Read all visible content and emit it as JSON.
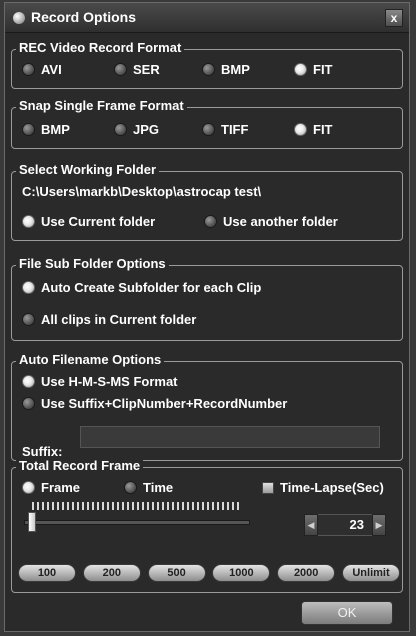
{
  "window": {
    "title": "Record Options",
    "close_label": "x"
  },
  "rec_video_format": {
    "legend": "REC Video Record Format",
    "options": [
      {
        "label": "AVI",
        "selected": false
      },
      {
        "label": "SER",
        "selected": false
      },
      {
        "label": "BMP",
        "selected": false
      },
      {
        "label": "FIT",
        "selected": true
      }
    ]
  },
  "snap_format": {
    "legend": "Snap Single Frame Format",
    "options": [
      {
        "label": "BMP",
        "selected": false
      },
      {
        "label": "JPG",
        "selected": false
      },
      {
        "label": "TIFF",
        "selected": false
      },
      {
        "label": "FIT",
        "selected": true
      }
    ]
  },
  "working_folder": {
    "legend": "Select Working Folder",
    "path": "C:\\Users\\markb\\Desktop\\astrocap test\\",
    "options": [
      {
        "label": "Use Current folder",
        "selected": true
      },
      {
        "label": "Use another folder",
        "selected": false
      }
    ]
  },
  "sub_folder": {
    "legend": "File Sub Folder Options",
    "options": [
      {
        "label": "Auto Create Subfolder for each Clip",
        "selected": true
      },
      {
        "label": "All clips in Current folder",
        "selected": false
      }
    ]
  },
  "auto_filename": {
    "legend": "Auto Filename Options",
    "options": [
      {
        "label": "Use H-M-S-MS Format",
        "selected": true
      },
      {
        "label": "Use Suffix+ClipNumber+RecordNumber",
        "selected": false
      }
    ],
    "suffix_label": "Suffix:",
    "suffix_value": ""
  },
  "total_record": {
    "legend": "Total Record Frame",
    "frame_label": "Frame",
    "frame_selected": true,
    "time_label": "Time",
    "time_selected": false,
    "timelapse_label": "Time-Lapse(Sec)",
    "timelapse_checked": false,
    "slider_fraction": 0.0,
    "spinner_value": "23",
    "spinner_left": "◀",
    "spinner_right": "▶",
    "presets": [
      "100",
      "200",
      "500",
      "1000",
      "2000",
      "Unlimit"
    ]
  },
  "ok_label": "OK"
}
